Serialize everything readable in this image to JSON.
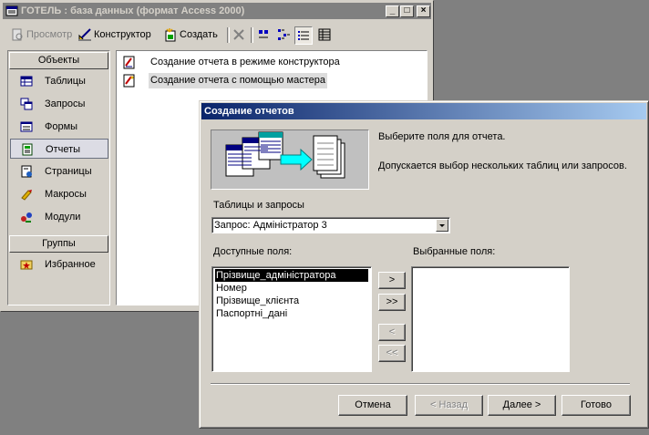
{
  "db_window": {
    "title": "ГОТЕЛЬ : база данных (формат Access 2000)",
    "controls": {
      "minimize": "_",
      "maximize": "□",
      "close": "×"
    },
    "toolbar": {
      "view": "Просмотр",
      "design": "Конструктор",
      "create": "Создать"
    },
    "groups_header": "Объекты",
    "objects": [
      {
        "label": "Таблицы",
        "icon": "table-icon"
      },
      {
        "label": "Запросы",
        "icon": "query-icon"
      },
      {
        "label": "Формы",
        "icon": "form-icon"
      },
      {
        "label": "Отчеты",
        "icon": "report-icon",
        "selected": true
      },
      {
        "label": "Страницы",
        "icon": "page-icon"
      },
      {
        "label": "Макросы",
        "icon": "macro-icon"
      },
      {
        "label": "Модули",
        "icon": "module-icon"
      }
    ],
    "groups_section": "Группы",
    "favorites": "Избранное",
    "shortcuts": [
      "Создание отчета в режиме конструктора",
      "Создание отчета с помощью мастера"
    ]
  },
  "wizard": {
    "title": "Создание отчетов",
    "instruction": "Выберите поля для отчета.",
    "hint": "Допускается выбор нескольких таблиц или запросов.",
    "tables_label": "Таблицы и запросы",
    "tables_value": "Запрос: Адміністратор 3",
    "available_label": "Доступные поля:",
    "selected_label": "Выбранные поля:",
    "available_fields": [
      "Прізвище_адміністратора",
      "Номер",
      "Прізвище_клієнта",
      "Паспортні_дані"
    ],
    "selected_fields": [],
    "move_buttons": {
      "one": ">",
      "all": ">>",
      "back_one": "<",
      "back_all": "<<"
    },
    "buttons": {
      "cancel": "Отмена",
      "back": "< Назад",
      "next": "Далее >",
      "finish": "Готово"
    }
  }
}
